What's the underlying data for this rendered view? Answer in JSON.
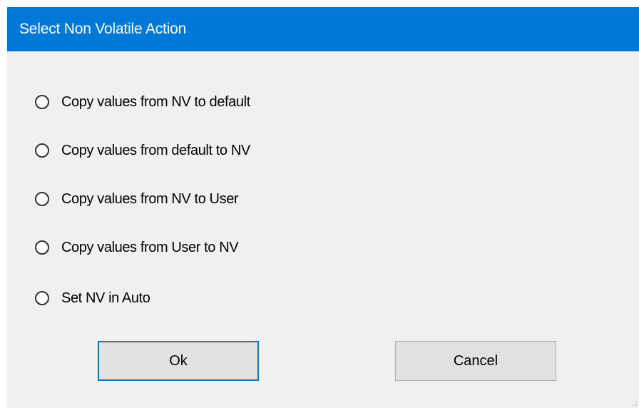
{
  "dialog": {
    "title": "Select Non Volatile Action",
    "options": [
      {
        "label": "Copy values from NV to default",
        "selected": false
      },
      {
        "label": "Copy values from default to NV",
        "selected": false
      },
      {
        "label": "Copy values from NV to User",
        "selected": false
      },
      {
        "label": "Copy values from User to NV",
        "selected": false
      },
      {
        "label": "Set NV in Auto",
        "selected": false
      }
    ],
    "buttons": {
      "ok_label": "Ok",
      "cancel_label": "Cancel"
    }
  },
  "colors": {
    "titlebar": "#0078d7",
    "title_text": "#ffffff",
    "client_bg": "#f0f0f0",
    "button_bg": "#e1e1e1",
    "default_button_border": "#0078d7"
  }
}
